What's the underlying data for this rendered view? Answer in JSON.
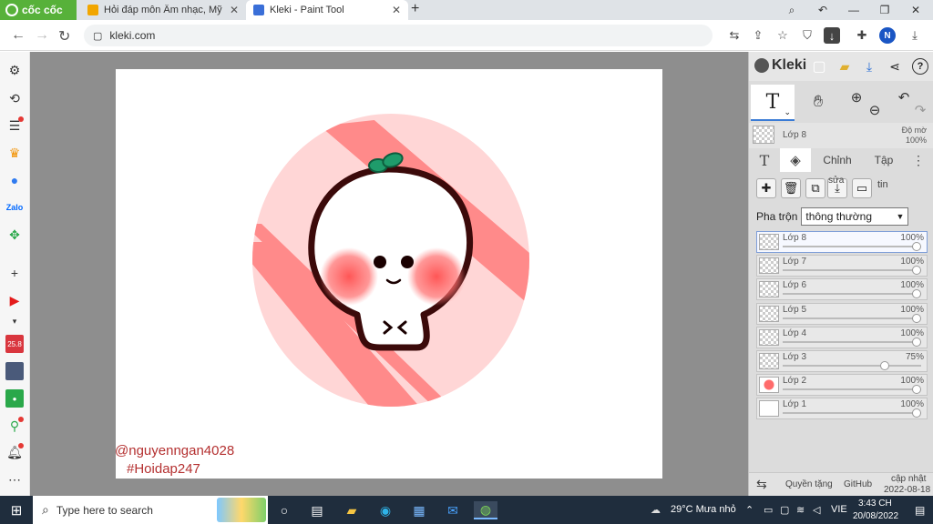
{
  "browser": {
    "brand": "cốc cốc",
    "tabs": [
      {
        "title": "Hỏi đáp môn Âm nhạc, Mỹ thuật",
        "active": false
      },
      {
        "title": "Kleki - Paint Tool",
        "active": true
      }
    ],
    "url": "kleki.com",
    "profile_initial": "N"
  },
  "canvas": {
    "watermark_user": "@nguyenngan4028",
    "watermark_tag": "#Hoidap247",
    "colors": {
      "bg_ellipse": "#ffd6d6",
      "stripe": "#ff8a8a",
      "outline": "#3b0a0a",
      "blush": "#ff5a5a",
      "sprout": "#1f9c6b"
    }
  },
  "kleki": {
    "app_name": "Kleki",
    "tool_label": "T",
    "current_layer": {
      "name": "Lớp 8",
      "opacity_label": "Độ mờ",
      "opacity": "100%"
    },
    "tabs": {
      "text_icon": "T",
      "edit": "Chỉnh",
      "file": "Tập",
      "more": "⋮"
    },
    "action_labels": {
      "edit": "sửa",
      "info": "tin"
    },
    "blend": {
      "label": "Pha trộn",
      "value": "thông thường"
    },
    "layers": [
      {
        "name": "Lớp 8",
        "opacity": "100%",
        "value": 1.0,
        "selected": true
      },
      {
        "name": "Lớp 7",
        "opacity": "100%",
        "value": 1.0
      },
      {
        "name": "Lớp 6",
        "opacity": "100%",
        "value": 1.0
      },
      {
        "name": "Lớp 5",
        "opacity": "100%",
        "value": 1.0
      },
      {
        "name": "Lớp 4",
        "opacity": "100%",
        "value": 1.0
      },
      {
        "name": "Lớp 3",
        "opacity": "75%",
        "value": 0.75
      },
      {
        "name": "Lớp 2",
        "opacity": "100%",
        "value": 1.0
      },
      {
        "name": "Lớp 1",
        "opacity": "100%",
        "value": 1.0
      }
    ],
    "footer": {
      "privacy": "Quyền tặng",
      "github": "GitHub",
      "updated_label": "cập nhật",
      "updated_date": "2022-08-18"
    }
  },
  "taskbar": {
    "search_placeholder": "Type here to search",
    "weather": "29°C  Mưa nhỏ",
    "lang": "VIE",
    "time": "3:43 CH",
    "date": "20/08/2022"
  }
}
